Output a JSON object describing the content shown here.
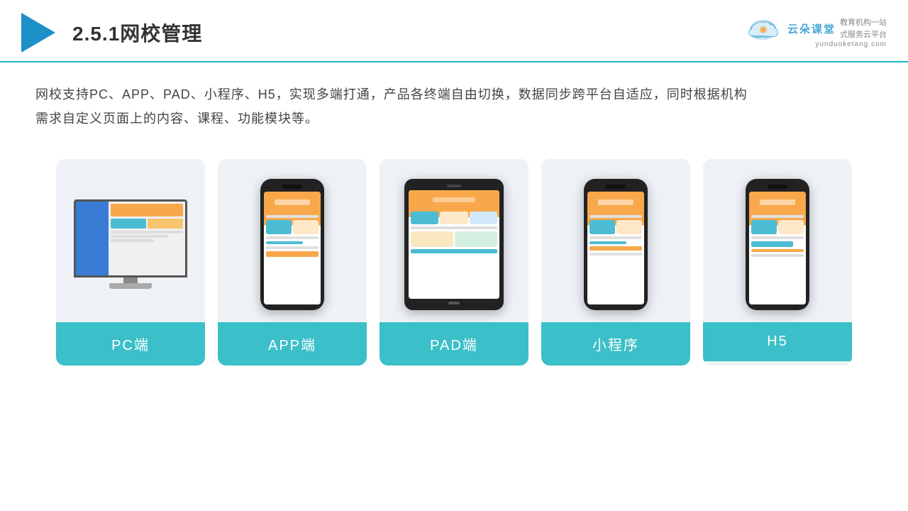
{
  "header": {
    "section_number": "2.5.1",
    "title": "网校管理",
    "logo_cn": "云朵课堂",
    "logo_en": "yunduoketang.com",
    "logo_slogan_line1": "教育机构一站",
    "logo_slogan_line2": "式服务云平台"
  },
  "description": {
    "text_line1": "网校支持PC、APP、PAD、小程序、H5，实现多端打通，产品各终端自由切换，数据同步跨平台自适应，同时根据机构",
    "text_line2": "需求自定义页面上的内容、课程、功能模块等。"
  },
  "cards": [
    {
      "id": "pc",
      "label": "PC端"
    },
    {
      "id": "app",
      "label": "APP端"
    },
    {
      "id": "pad",
      "label": "PAD端"
    },
    {
      "id": "miniprogram",
      "label": "小程序"
    },
    {
      "id": "h5",
      "label": "H5"
    }
  ],
  "colors": {
    "accent": "#3bbfc8",
    "header_line": "#1ab5c8",
    "card_bg": "#eef2f7"
  }
}
